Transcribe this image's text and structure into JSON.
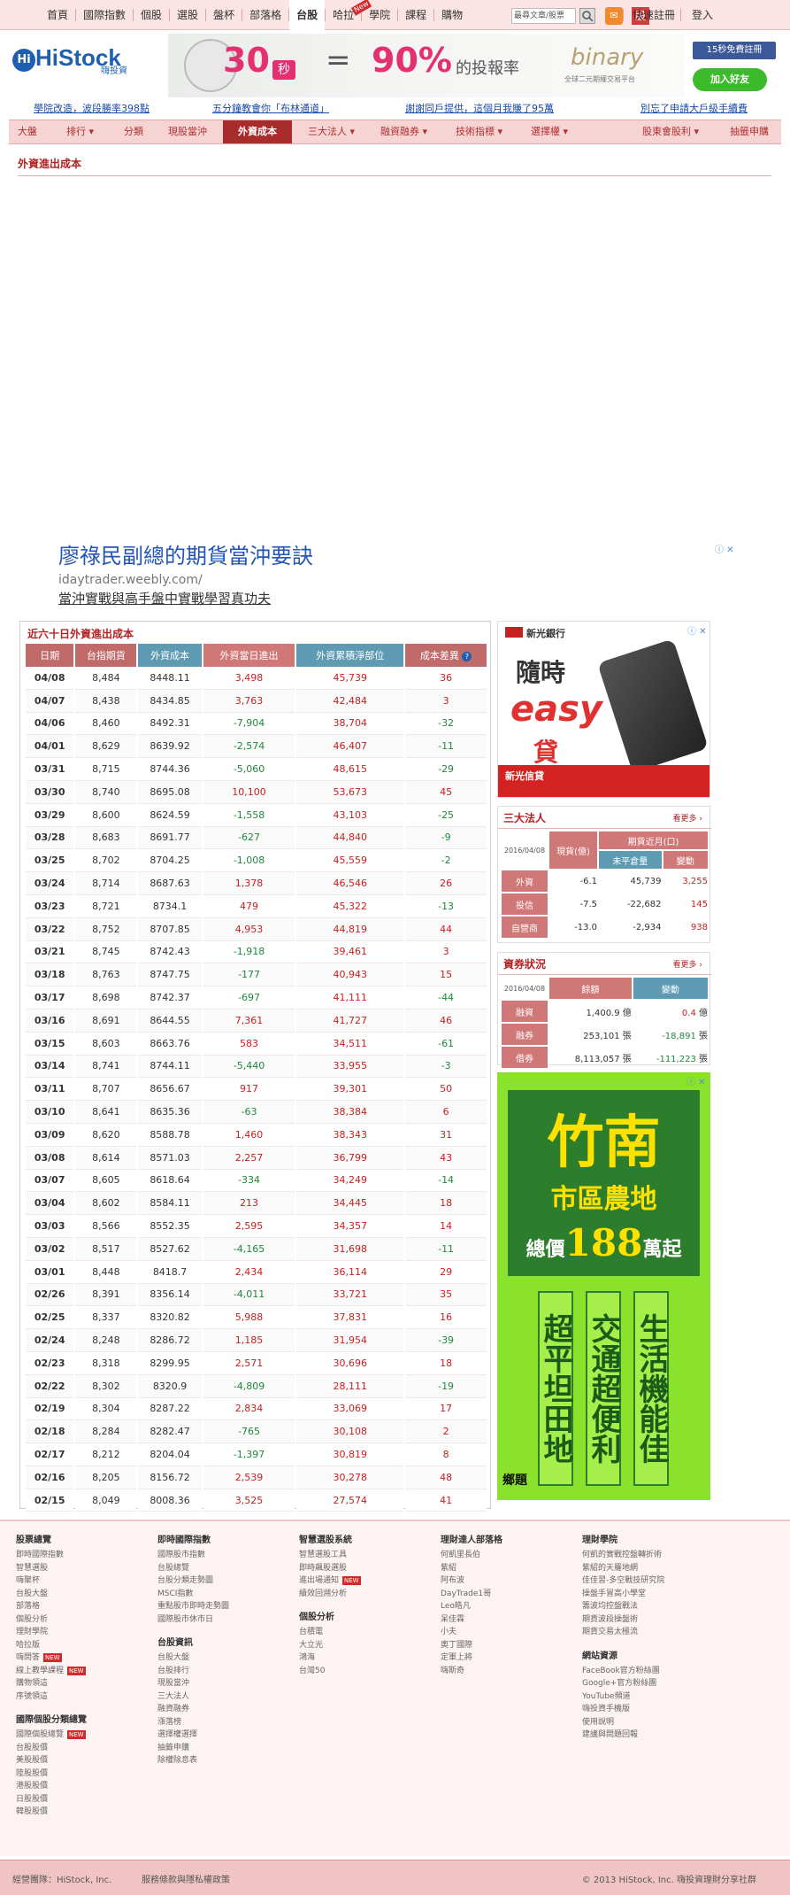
{
  "topnav": {
    "items": [
      "首頁",
      "國際指數",
      "個股",
      "選股",
      "盤杯",
      "部落格",
      "台股",
      "哈拉",
      "New",
      "學院",
      "課程",
      "購物",
      "快速註冊",
      "登入"
    ],
    "search_placeholder": "最尋文章/股票",
    "stock_label": "股",
    "mail_label": "✉"
  },
  "header": {
    "logo_text": "HiStock",
    "logo_sub": "嗨投資",
    "banner_big1": "30",
    "banner_unit": "秒",
    "banner_eq": "=",
    "banner_big2": "90%",
    "banner_text": "的投報率",
    "banner_brand": "binary",
    "banner_brand_sub": "全球二元期權交易平台",
    "fb_label": "15秒免費註冊",
    "line_label": "加入好友"
  },
  "headlines": [
    "學院改造，波段勝率398點",
    "五分鐘教會你「布林通道」",
    "謝謝同戶提供，這個月我賺了95萬",
    "別忘了申請大戶級手續費"
  ],
  "subnav": {
    "items": [
      "大盤",
      "排行",
      "分類",
      "現股當沖",
      "外資成本",
      "三大法人",
      "融資融券",
      "技術指標",
      "選擇權",
      "股東會股利",
      "抽籤申購"
    ],
    "active": "外資成本"
  },
  "page_title": "外資進出成本",
  "ad": {
    "headline": "廖祿民副總的期貨當沖要訣",
    "url": "idaytrader.weebly.com/",
    "desc": "當沖實戰與高手盤中實戰學習真功夫"
  },
  "table": {
    "title": "近六十日外資進出成本",
    "headers": [
      "日期",
      "台指期貨",
      "外資成本",
      "外資當日進出",
      "外資累積淨部位",
      "成本差異"
    ],
    "header_colors": [
      "#c06a6a",
      "#c06a6a",
      "#5e9bb3",
      "#d07878",
      "#5e9bb3",
      "#c06a6a"
    ],
    "rows": [
      [
        "04/08",
        "8,484",
        "8448.11",
        "3,498",
        "45,739",
        "36"
      ],
      [
        "04/07",
        "8,438",
        "8434.85",
        "3,763",
        "42,484",
        "3"
      ],
      [
        "04/06",
        "8,460",
        "8492.31",
        "-7,904",
        "38,704",
        "-32"
      ],
      [
        "04/01",
        "8,629",
        "8639.92",
        "-2,574",
        "46,407",
        "-11"
      ],
      [
        "03/31",
        "8,715",
        "8744.36",
        "-5,060",
        "48,615",
        "-29"
      ],
      [
        "03/30",
        "8,740",
        "8695.08",
        "10,100",
        "53,673",
        "45"
      ],
      [
        "03/29",
        "8,600",
        "8624.59",
        "-1,558",
        "43,103",
        "-25"
      ],
      [
        "03/28",
        "8,683",
        "8691.77",
        "-627",
        "44,840",
        "-9"
      ],
      [
        "03/25",
        "8,702",
        "8704.25",
        "-1,008",
        "45,559",
        "-2"
      ],
      [
        "03/24",
        "8,714",
        "8687.63",
        "1,378",
        "46,546",
        "26"
      ],
      [
        "03/23",
        "8,721",
        "8734.1",
        "479",
        "45,322",
        "-13"
      ],
      [
        "03/22",
        "8,752",
        "8707.85",
        "4,953",
        "44,819",
        "44"
      ],
      [
        "03/21",
        "8,745",
        "8742.43",
        "-1,918",
        "39,461",
        "3"
      ],
      [
        "03/18",
        "8,763",
        "8747.75",
        "-177",
        "40,943",
        "15"
      ],
      [
        "03/17",
        "8,698",
        "8742.37",
        "-697",
        "41,111",
        "-44"
      ],
      [
        "03/16",
        "8,691",
        "8644.55",
        "7,361",
        "41,727",
        "46"
      ],
      [
        "03/15",
        "8,603",
        "8663.76",
        "583",
        "34,511",
        "-61"
      ],
      [
        "03/14",
        "8,741",
        "8744.11",
        "-5,440",
        "33,955",
        "-3"
      ],
      [
        "03/11",
        "8,707",
        "8656.67",
        "917",
        "39,301",
        "50"
      ],
      [
        "03/10",
        "8,641",
        "8635.36",
        "-63",
        "38,384",
        "6"
      ],
      [
        "03/09",
        "8,620",
        "8588.78",
        "1,460",
        "38,343",
        "31"
      ],
      [
        "03/08",
        "8,614",
        "8571.03",
        "2,257",
        "36,799",
        "43"
      ],
      [
        "03/07",
        "8,605",
        "8618.64",
        "-334",
        "34,249",
        "-14"
      ],
      [
        "03/04",
        "8,602",
        "8584.11",
        "213",
        "34,445",
        "18"
      ],
      [
        "03/03",
        "8,566",
        "8552.35",
        "2,595",
        "34,357",
        "14"
      ],
      [
        "03/02",
        "8,517",
        "8527.62",
        "-4,165",
        "31,698",
        "-11"
      ],
      [
        "03/01",
        "8,448",
        "8418.7",
        "2,434",
        "36,114",
        "29"
      ],
      [
        "02/26",
        "8,391",
        "8356.14",
        "-4,011",
        "33,721",
        "35"
      ],
      [
        "02/25",
        "8,337",
        "8320.82",
        "5,988",
        "37,831",
        "16"
      ],
      [
        "02/24",
        "8,248",
        "8286.72",
        "1,185",
        "31,954",
        "-39"
      ],
      [
        "02/23",
        "8,318",
        "8299.95",
        "2,571",
        "30,696",
        "18"
      ],
      [
        "02/22",
        "8,302",
        "8320.9",
        "-4,809",
        "28,111",
        "-19"
      ],
      [
        "02/19",
        "8,304",
        "8287.22",
        "2,834",
        "33,069",
        "17"
      ],
      [
        "02/18",
        "8,284",
        "8282.47",
        "-765",
        "30,108",
        "2"
      ],
      [
        "02/17",
        "8,212",
        "8204.04",
        "-1,397",
        "30,819",
        "8"
      ],
      [
        "02/16",
        "8,205",
        "8156.72",
        "2,539",
        "30,278",
        "48"
      ],
      [
        "02/15",
        "8,049",
        "8008.36",
        "3,525",
        "27,574",
        "41"
      ]
    ]
  },
  "ad_right1": {
    "brand": "新光銀行",
    "line1": "隨時",
    "line2": "easy",
    "line3": "貸",
    "footer": "新光信貸"
  },
  "institutional": {
    "title": "三大法人",
    "more": "看更多",
    "date": "2016/04/08",
    "col_spot": "現貨(億)",
    "col_fut": "期貨近月(口)",
    "col_open": "未平倉量",
    "col_chg": "變動",
    "rows": [
      {
        "name": "外資",
        "spot": "-6.1",
        "open": "45,739",
        "chg": "3,255"
      },
      {
        "name": "投信",
        "spot": "-7.5",
        "open": "-22,682",
        "chg": "145"
      },
      {
        "name": "自營商",
        "spot": "-13.0",
        "open": "-2,934",
        "chg": "938"
      }
    ]
  },
  "margin": {
    "title": "資券狀況",
    "more": "看更多",
    "date": "2016/04/08",
    "col_balance": "餘額",
    "col_change": "變動",
    "rows": [
      {
        "name": "融資",
        "balance": "1,400.9",
        "unit": "億",
        "change": "0.4",
        "cunit": "億"
      },
      {
        "name": "融券",
        "balance": "253,101",
        "unit": "張",
        "change": "-18,891",
        "cunit": "張"
      },
      {
        "name": "借券",
        "balance": "8,113,057",
        "unit": "張",
        "change": "-111,223",
        "cunit": "張"
      }
    ]
  },
  "ad_right2": {
    "title": "竹南",
    "sub": "市區農地",
    "price_pre": "總價",
    "price": "188",
    "price_post": "萬起",
    "cols": [
      "超平坦田地",
      "交通超便利",
      "生活機能佳"
    ],
    "logo": "鄉題"
  },
  "footer": {
    "cols": [
      {
        "head": "股票總覽",
        "items": [
          "即時國際指數",
          "智慧選股",
          "嗨聚杯",
          "台股大盤",
          "部落格",
          "個股分析",
          "理財學院",
          "哈拉版",
          "嗨問答",
          "線上教學課程",
          "購物領這",
          "序號領這"
        ],
        "new": [
          8,
          9
        ]
      },
      {
        "head": "即時國際指數",
        "items": [
          "國際股市指數",
          "台股總覽",
          "台股分類走勢圖",
          "MSCI指數",
          "重點股市即時走勢圖",
          "國際股市休市日"
        ],
        "head2": "台股資訊",
        "items2": [
          "台股大盤",
          "台股排行",
          "現股當沖",
          "三大法人",
          "融資融券",
          "漲落榜",
          "選擇權選擇",
          "抽籤申購",
          "除權除息表"
        ]
      },
      {
        "head": "智慧選股系統",
        "items": [
          "智慧選股工具",
          "即時飆股選股",
          "進出場通知",
          "績效回溯分析"
        ],
        "new": [
          2
        ],
        "head2": "個股分析",
        "items2": [
          "台積電",
          "大立光",
          "鴻海",
          "台灣50"
        ]
      },
      {
        "head": "理財達人部落格",
        "items": [
          "何凱里長伯",
          "紫紹",
          "阿布波",
          "DayTrade1哥",
          "Leo皓凡",
          "呆佳霖",
          "小夫",
          "奧丁國際",
          "定軍上將",
          "嗨斯奇"
        ]
      },
      {
        "head": "理財學院",
        "items": [
          "何凱的實戰控盤轉折術",
          "紫紹的天羅地網",
          "佳佳習-多空戰技研究院",
          "操盤手冒高小學堂",
          "籌波均控盤戰法",
          "期貨波段操盤術",
          "期貨交易太極流"
        ],
        "head2": "網站資源",
        "items2": [
          "FaceBook官方粉絲團",
          "Google+官方粉絲團",
          "YouTube頻道",
          "嗨投資手機版",
          "使用說明",
          "建議與問題回報"
        ]
      }
    ],
    "copyright_left": "經營團隊：HiStock, Inc.",
    "terms": "服務條款與隱私權政策",
    "copyright_right": "© 2013 HiStock, Inc. 嗨投資理財分享社群"
  }
}
